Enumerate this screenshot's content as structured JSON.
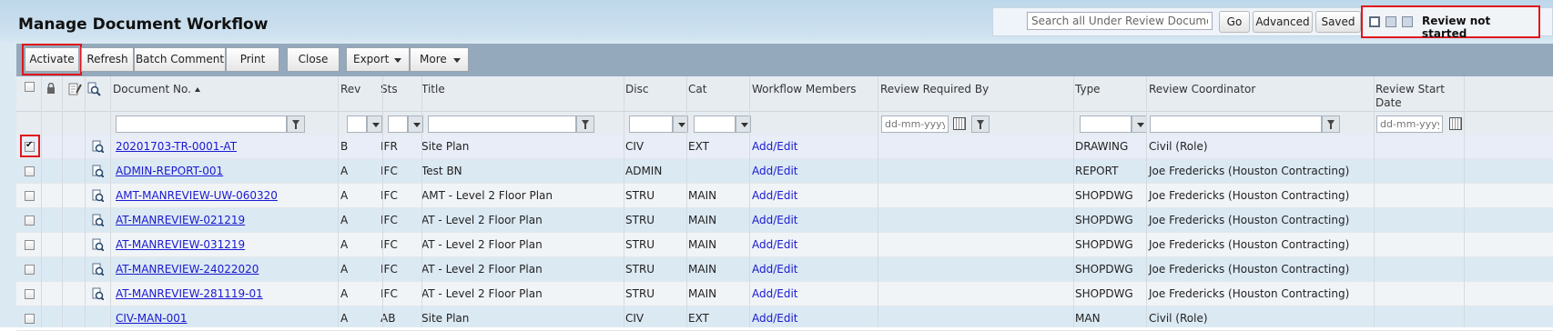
{
  "page": {
    "title": "Manage Document Workflow"
  },
  "search": {
    "placeholder": "Search all Under Review Documents",
    "go_label": "Go",
    "advanced_label": "Advanced",
    "saved_label": "Saved"
  },
  "view": {
    "label": "Review not started"
  },
  "toolbar": {
    "activate": "Activate",
    "refresh": "Refresh",
    "batch_comment": "Batch Comment",
    "print": "Print",
    "close": "Close",
    "export": "Export",
    "more": "More"
  },
  "columns": {
    "document_no": "Document No.",
    "rev": "Rev",
    "sts": "Sts",
    "title": "Title",
    "disc": "Disc",
    "cat": "Cat",
    "workflow_members": "Workflow Members",
    "review_required_by": "Review Required By",
    "type": "Type",
    "review_coordinator": "Review Coordinator",
    "review_start_date": "Review Start Date"
  },
  "filters": {
    "date_placeholder": "dd-mm-yyyy"
  },
  "rows": [
    {
      "doc": "20201703-TR-0001-AT",
      "rev": "B",
      "sts": "IFR",
      "title": "Site Plan",
      "disc": "CIV",
      "cat": "EXT",
      "members": "Add/Edit",
      "type": "DRAWING",
      "coordinator": "Civil (Role)",
      "checked": true
    },
    {
      "doc": "ADMIN-REPORT-001",
      "rev": "A",
      "sts": "IFC",
      "title": "Test BN",
      "disc": "ADMIN",
      "cat": "",
      "members": "Add/Edit",
      "type": "REPORT",
      "coordinator": "Joe Fredericks (Houston Contracting)",
      "checked": false
    },
    {
      "doc": "AMT-MANREVIEW-UW-060320",
      "rev": "A",
      "sts": "IFC",
      "title": "AMT - Level 2 Floor Plan",
      "disc": "STRU",
      "cat": "MAIN",
      "members": "Add/Edit",
      "type": "SHOPDWG",
      "coordinator": "Joe Fredericks (Houston Contracting)",
      "checked": false
    },
    {
      "doc": "AT-MANREVIEW-021219",
      "rev": "A",
      "sts": "IFC",
      "title": "AT - Level 2 Floor Plan",
      "disc": "STRU",
      "cat": "MAIN",
      "members": "Add/Edit",
      "type": "SHOPDWG",
      "coordinator": "Joe Fredericks (Houston Contracting)",
      "checked": false
    },
    {
      "doc": "AT-MANREVIEW-031219",
      "rev": "A",
      "sts": "IFC",
      "title": "AT - Level 2 Floor Plan",
      "disc": "STRU",
      "cat": "MAIN",
      "members": "Add/Edit",
      "type": "SHOPDWG",
      "coordinator": "Joe Fredericks (Houston Contracting)",
      "checked": false
    },
    {
      "doc": "AT-MANREVIEW-24022020",
      "rev": "A",
      "sts": "IFC",
      "title": "AT - Level 2 Floor Plan",
      "disc": "STRU",
      "cat": "MAIN",
      "members": "Add/Edit",
      "type": "SHOPDWG",
      "coordinator": "Joe Fredericks (Houston Contracting)",
      "checked": false
    },
    {
      "doc": "AT-MANREVIEW-281119-01",
      "rev": "A",
      "sts": "IFC",
      "title": "AT - Level 2 Floor Plan",
      "disc": "STRU",
      "cat": "MAIN",
      "members": "Add/Edit",
      "type": "SHOPDWG",
      "coordinator": "Joe Fredericks (Houston Contracting)",
      "checked": false
    },
    {
      "doc": "CIV-MAN-001",
      "rev": "A",
      "sts": "AB",
      "title": "Site Plan",
      "disc": "CIV",
      "cat": "EXT",
      "members": "Add/Edit",
      "type": "MAN",
      "coordinator": "Civil (Role)",
      "checked": false
    }
  ]
}
